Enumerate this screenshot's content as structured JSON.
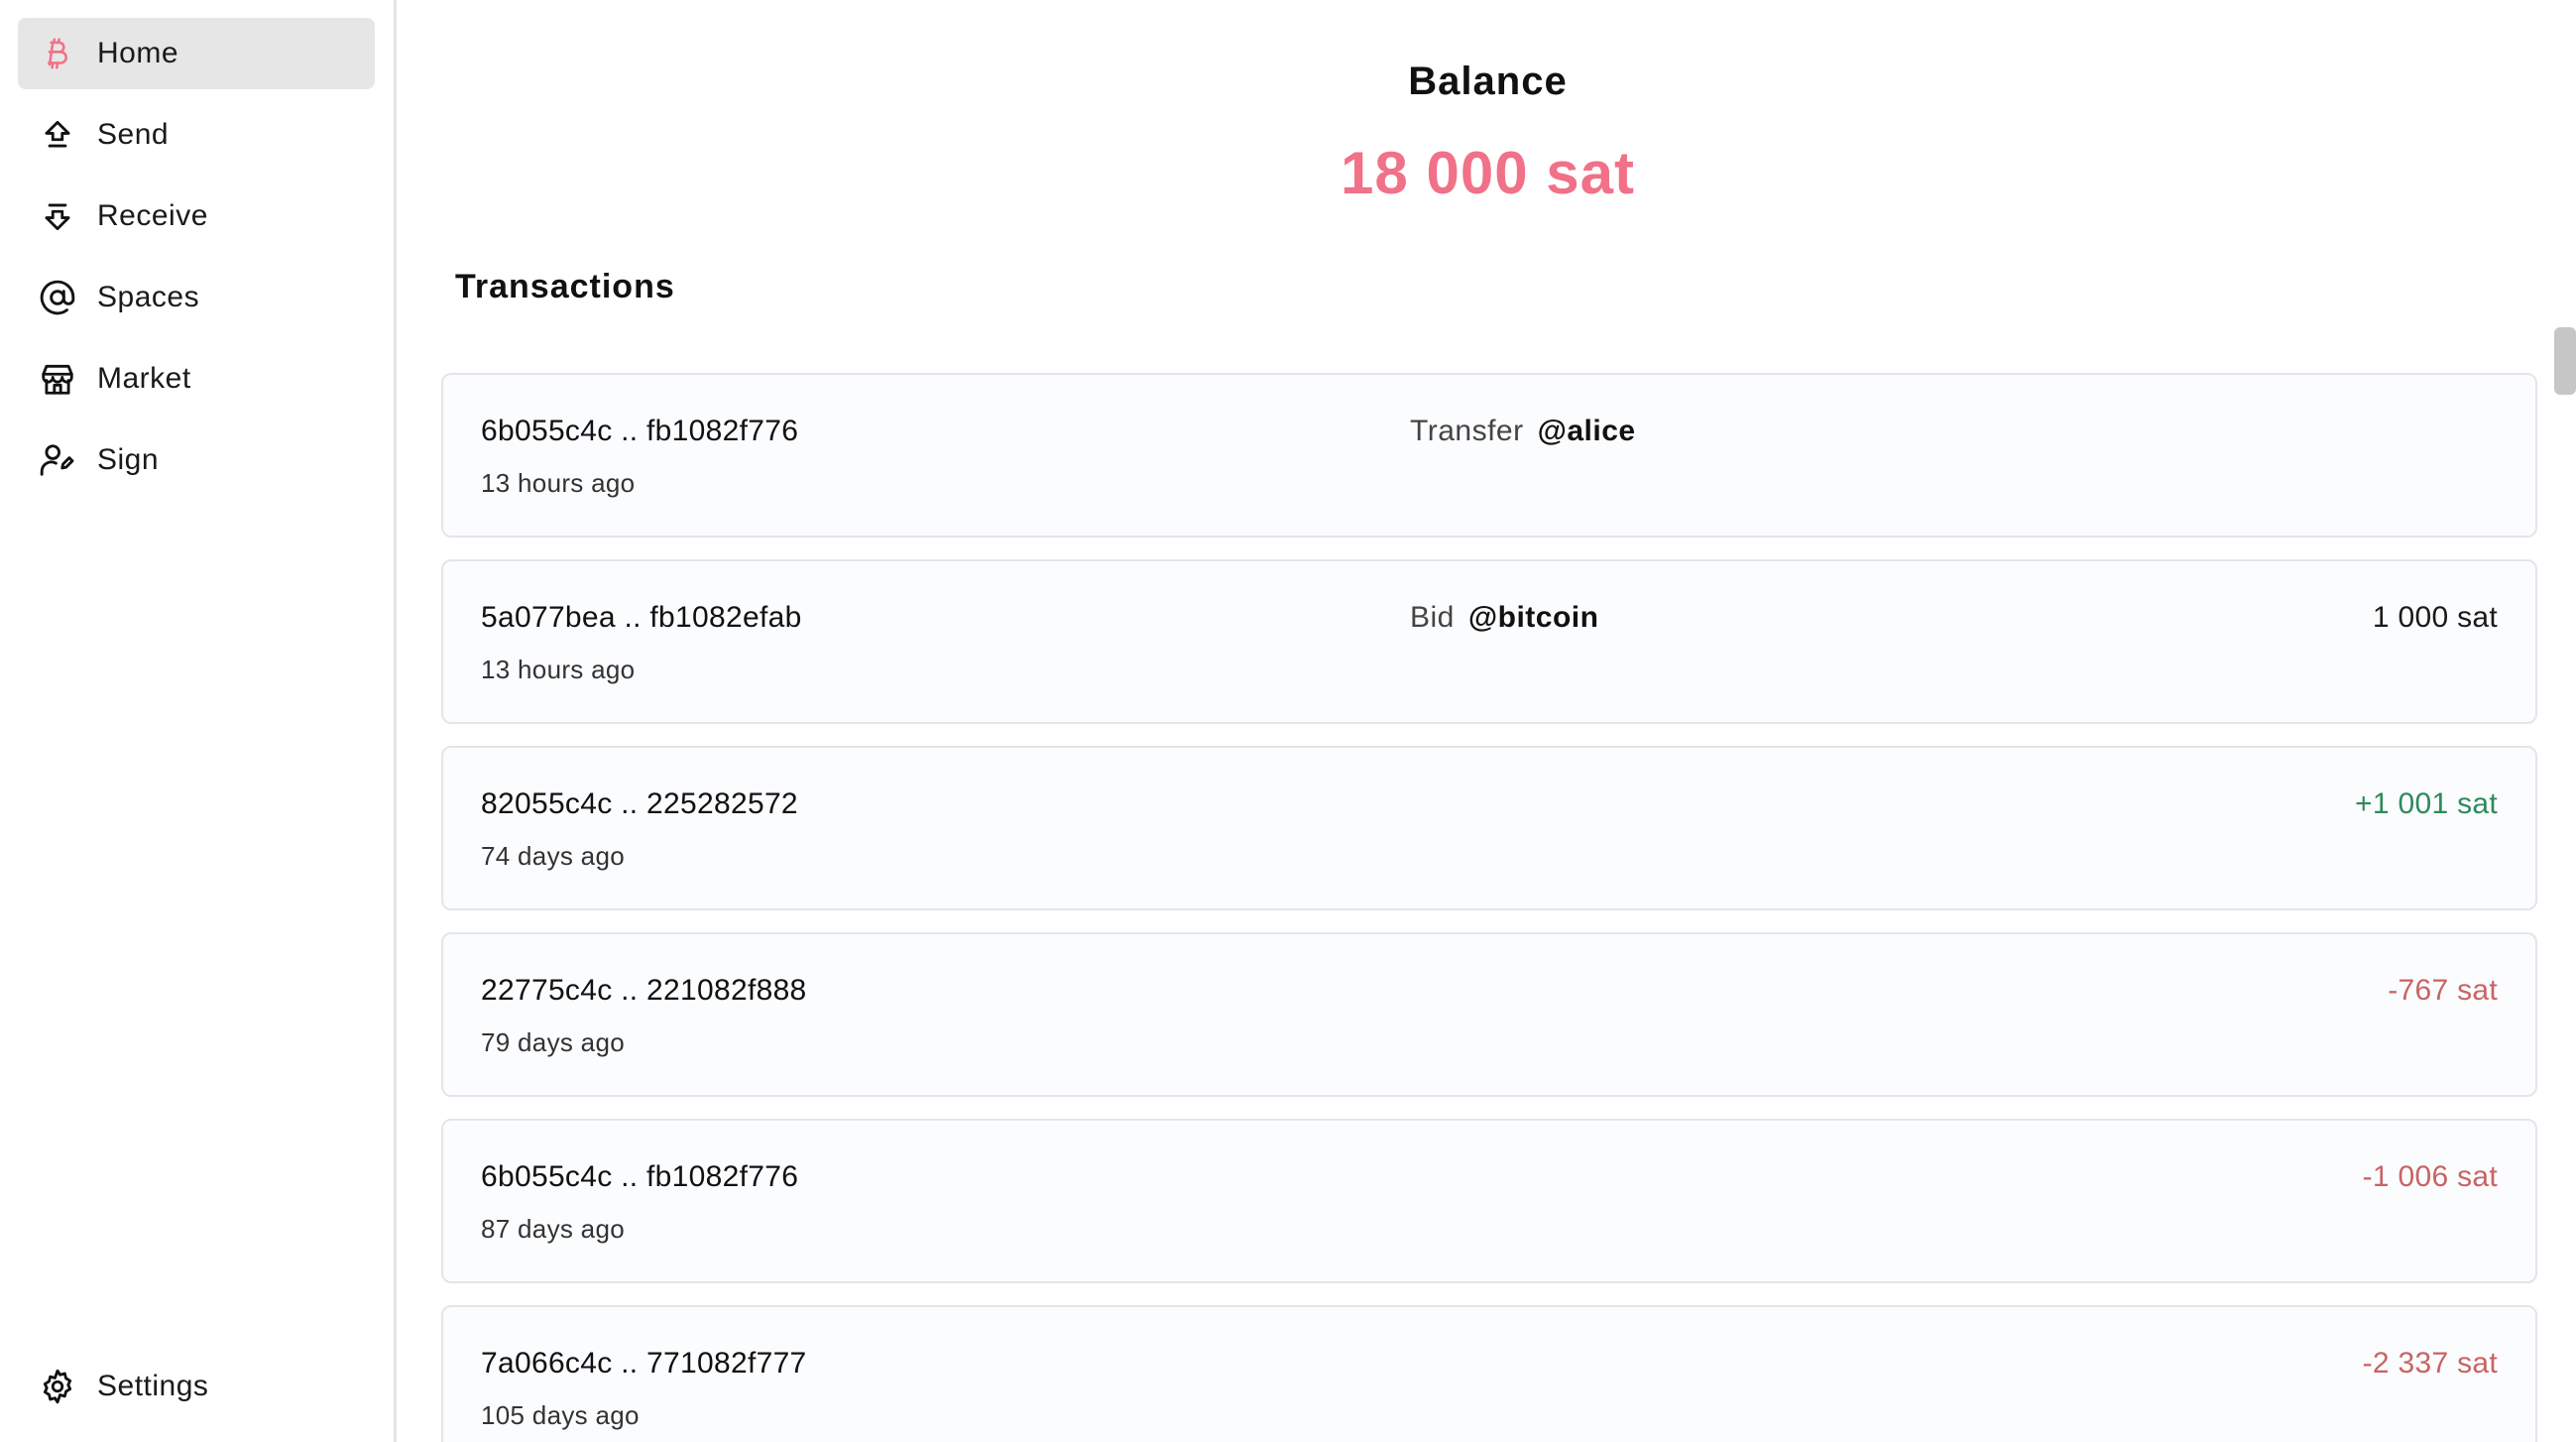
{
  "sidebar": {
    "items": [
      {
        "label": "Home",
        "icon": "bitcoin-icon",
        "active": true
      },
      {
        "label": "Send",
        "icon": "send-icon",
        "active": false
      },
      {
        "label": "Receive",
        "icon": "receive-icon",
        "active": false
      },
      {
        "label": "Spaces",
        "icon": "at-sign-icon",
        "active": false
      },
      {
        "label": "Market",
        "icon": "store-icon",
        "active": false
      },
      {
        "label": "Sign",
        "icon": "user-pen-icon",
        "active": false
      }
    ],
    "settings": {
      "label": "Settings",
      "icon": "gear-icon"
    }
  },
  "balance": {
    "title": "Balance",
    "amount": "18 000 sat"
  },
  "transactions": {
    "heading": "Transactions",
    "items": [
      {
        "id": "6b055c4c .. fb1082f776",
        "time": "13 hours ago",
        "action_type": "Transfer",
        "action_space": "@alice",
        "amount": ""
      },
      {
        "id": "5a077bea .. fb1082efab",
        "time": "13 hours ago",
        "action_type": "Bid",
        "action_space": "@bitcoin",
        "amount": "1 000 sat"
      },
      {
        "id": "82055c4c .. 225282572",
        "time": "74 days ago",
        "action_type": "",
        "action_space": "",
        "amount": "+1 001 sat"
      },
      {
        "id": "22775c4c .. 221082f888",
        "time": "79 days ago",
        "action_type": "",
        "action_space": "",
        "amount": "-767 sat"
      },
      {
        "id": "6b055c4c .. fb1082f776",
        "time": "87 days ago",
        "action_type": "",
        "action_space": "",
        "amount": "-1 006 sat"
      },
      {
        "id": "7a066c4c .. 771082f777",
        "time": "105 days ago",
        "action_type": "",
        "action_space": "",
        "amount": "-2 337 sat"
      }
    ]
  },
  "colors": {
    "accent": "#f07188",
    "positive": "#2e8a5b",
    "negative": "#c86464",
    "active_nav_bg": "#e6e6e6",
    "card_bg": "#fbfcfe"
  }
}
